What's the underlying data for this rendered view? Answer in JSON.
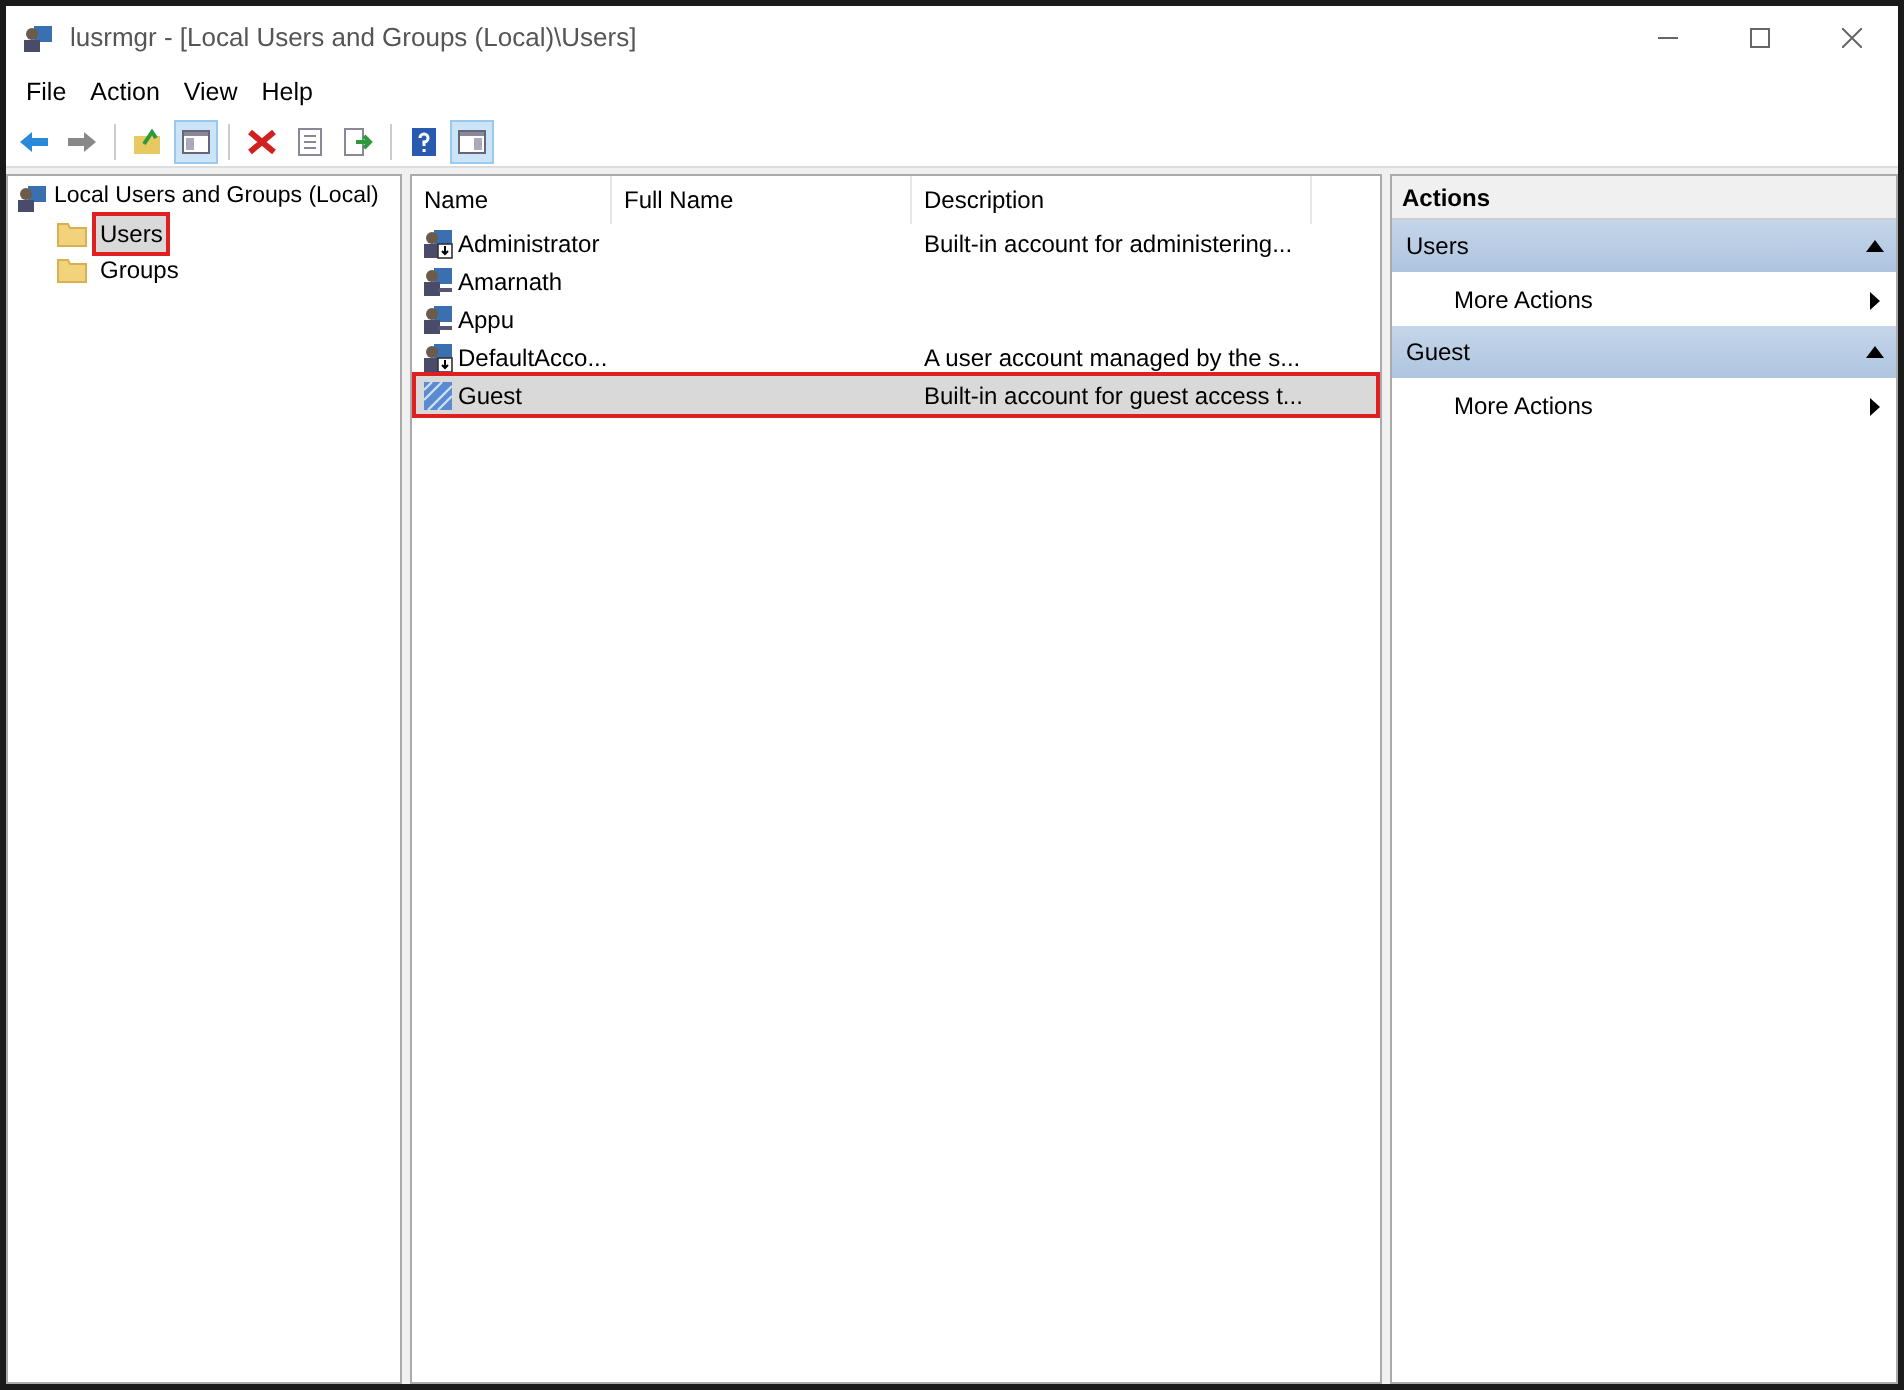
{
  "window": {
    "title": "lusrmgr - [Local Users and Groups (Local)\\Users]"
  },
  "menu": [
    "File",
    "Action",
    "View",
    "Help"
  ],
  "toolbar": [
    {
      "kind": "back",
      "pressed": false
    },
    {
      "kind": "forward",
      "pressed": false
    },
    {
      "kind": "sep"
    },
    {
      "kind": "up",
      "pressed": false
    },
    {
      "kind": "tree",
      "pressed": true
    },
    {
      "kind": "sep"
    },
    {
      "kind": "delete",
      "pressed": false
    },
    {
      "kind": "properties",
      "pressed": false
    },
    {
      "kind": "export",
      "pressed": false
    },
    {
      "kind": "sep"
    },
    {
      "kind": "help",
      "pressed": false
    },
    {
      "kind": "actionpane",
      "pressed": true
    }
  ],
  "tree": {
    "label": "Local Users and Groups (Local)",
    "children": [
      {
        "label": "Users",
        "selected": true
      },
      {
        "label": "Groups",
        "selected": false
      }
    ]
  },
  "table": {
    "columns": [
      "Name",
      "Full Name",
      "Description"
    ],
    "rows": [
      {
        "kind": "admin",
        "name": "Administrator",
        "full_name": "",
        "description": "Built-in account for administering...",
        "selected": false
      },
      {
        "kind": "user",
        "name": "Amarnath",
        "full_name": "",
        "description": "",
        "selected": false
      },
      {
        "kind": "user",
        "name": "Appu",
        "full_name": "",
        "description": "",
        "selected": false
      },
      {
        "kind": "admin",
        "name": "DefaultAcco...",
        "full_name": "",
        "description": "A user account managed by the s...",
        "selected": false
      },
      {
        "kind": "guest",
        "name": "Guest",
        "full_name": "",
        "description": "Built-in account for guest access t...",
        "selected": true
      }
    ]
  },
  "actions": {
    "title": "Actions",
    "sections": [
      {
        "title": "Users",
        "expanded": true,
        "items": [
          "More Actions"
        ]
      },
      {
        "title": "Guest",
        "expanded": true,
        "items": [
          "More Actions"
        ]
      }
    ]
  }
}
